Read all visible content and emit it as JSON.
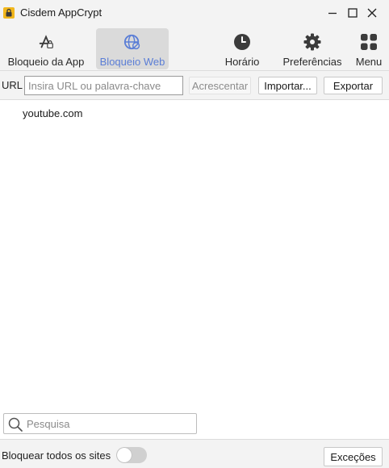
{
  "window": {
    "title": "Cisdem AppCrypt",
    "icons": {
      "app": "lock-app-icon",
      "minimize": "minimize-icon",
      "maximize": "maximize-icon",
      "close": "close-icon"
    }
  },
  "toolbar": {
    "items": [
      {
        "label": "Bloqueio da App",
        "icon": "app-lock-icon",
        "active": false
      },
      {
        "label": "Bloqueio Web",
        "icon": "web-block-icon",
        "active": true
      },
      {
        "label": "Horário",
        "icon": "clock-icon",
        "active": false
      },
      {
        "label": "Preferências",
        "icon": "gear-icon",
        "active": false
      },
      {
        "label": "Menu",
        "icon": "grid-icon",
        "active": false
      }
    ],
    "accent_color": "#5b7ed6"
  },
  "url_bar": {
    "label": "URL",
    "input_placeholder": "Insira URL ou palavra-chave",
    "input_value": "",
    "add_label": "Acrescentar",
    "import_label": "Importar...",
    "export_label": "Exportar"
  },
  "blocked_sites": [
    "youtube.com"
  ],
  "search": {
    "placeholder": "Pesquisa",
    "value": "",
    "icon": "search-icon"
  },
  "footer": {
    "block_all_label": "Bloquear todos os sites",
    "block_all_enabled": false,
    "exceptions_label": "Exceções"
  }
}
